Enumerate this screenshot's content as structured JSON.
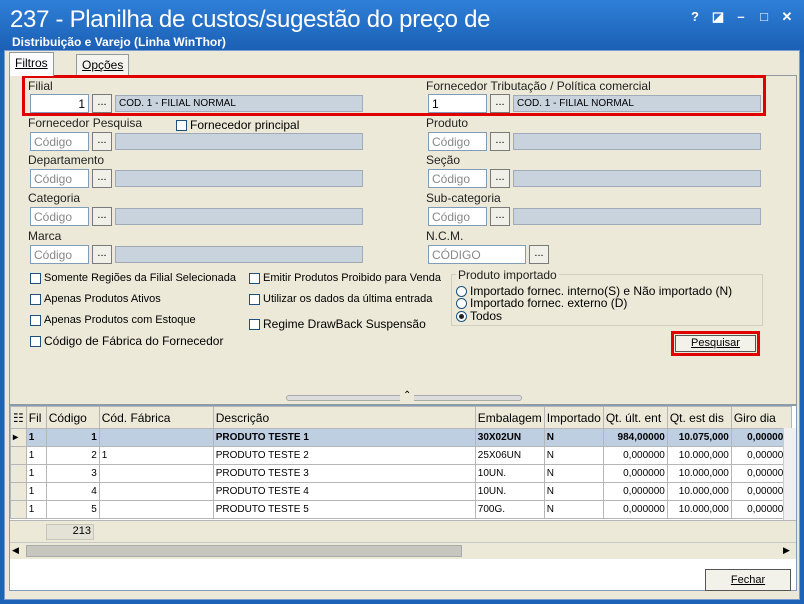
{
  "window": {
    "title": "237 - Planilha de custos/sugestão do preço de",
    "subtitle": "Distribuição e Varejo (Linha WinThor)",
    "help": "?",
    "restore": "◪",
    "minimize": "–",
    "maximize": "□",
    "close": "✕"
  },
  "tabs": [
    "Filtros",
    "Opções"
  ],
  "filters": {
    "filial_label": "Filial",
    "filial_value": "1",
    "filial_desc": "COD. 1 - FILIAL NORMAL",
    "fornec_trib_label": "Fornecedor Tributação / Política comercial",
    "fornec_trib_value": "1",
    "fornec_trib_desc": "COD. 1 - FILIAL NORMAL",
    "fornec_pesq_label": "Fornecedor Pesquisa",
    "fornec_principal_label": "Fornecedor principal",
    "produto_label": "Produto",
    "departamento_label": "Departamento",
    "secao_label": "Seção",
    "categoria_label": "Categoria",
    "subcategoria_label": "Sub-categoria",
    "marca_label": "Marca",
    "ncm_label": "N.C.M.",
    "codigo_placeholder": "Código",
    "codigo_upper": "CÓDIGO",
    "dots": "..."
  },
  "checks": {
    "c1": "Somente Regiões da Filial Selecionada",
    "c2": "Apenas Produtos Ativos",
    "c3": "Apenas Produtos com Estoque",
    "c4": "Código de Fábrica do Fornecedor",
    "c5": "Emitir Produtos Proibido para Venda",
    "c6": "Utilizar os dados da última entrada",
    "c7": "Regime DrawBack Suspensão"
  },
  "importado": {
    "label": "Produto importado",
    "r1": "Importado fornec. interno(S) e Não importado (N)",
    "r2": "Importado fornec. externo (D)",
    "r3": "Todos"
  },
  "pesquisar": "Pesquisar",
  "fechar": "Fechar",
  "grid": {
    "headers": [
      "Fil",
      "Código",
      "Cód. Fábrica",
      "Descrição",
      "Embalagem",
      "Importado",
      "Qt. últ. ent",
      "Qt. est dis",
      "Giro dia"
    ],
    "rows": [
      [
        "1",
        "1",
        "",
        "PRODUTO TESTE 1",
        "30X02UN",
        "N",
        "984,00000",
        "10.075,000",
        "0,000000"
      ],
      [
        "1",
        "2",
        "1",
        "PRODUTO TESTE 2",
        "25X06UN",
        "N",
        "0,000000",
        "10.000,000",
        "0,000000"
      ],
      [
        "1",
        "3",
        "",
        "PRODUTO TESTE 3",
        "10UN.",
        "N",
        "0,000000",
        "10.000,000",
        "0,000000"
      ],
      [
        "1",
        "4",
        "",
        "PRODUTO TESTE 4",
        "10UN.",
        "N",
        "0,000000",
        "10.000,000",
        "0,000000"
      ],
      [
        "1",
        "5",
        "",
        "PRODUTO TESTE 5",
        "700G.",
        "N",
        "0,000000",
        "10.000,000",
        "0,000000"
      ]
    ],
    "total": "213"
  }
}
